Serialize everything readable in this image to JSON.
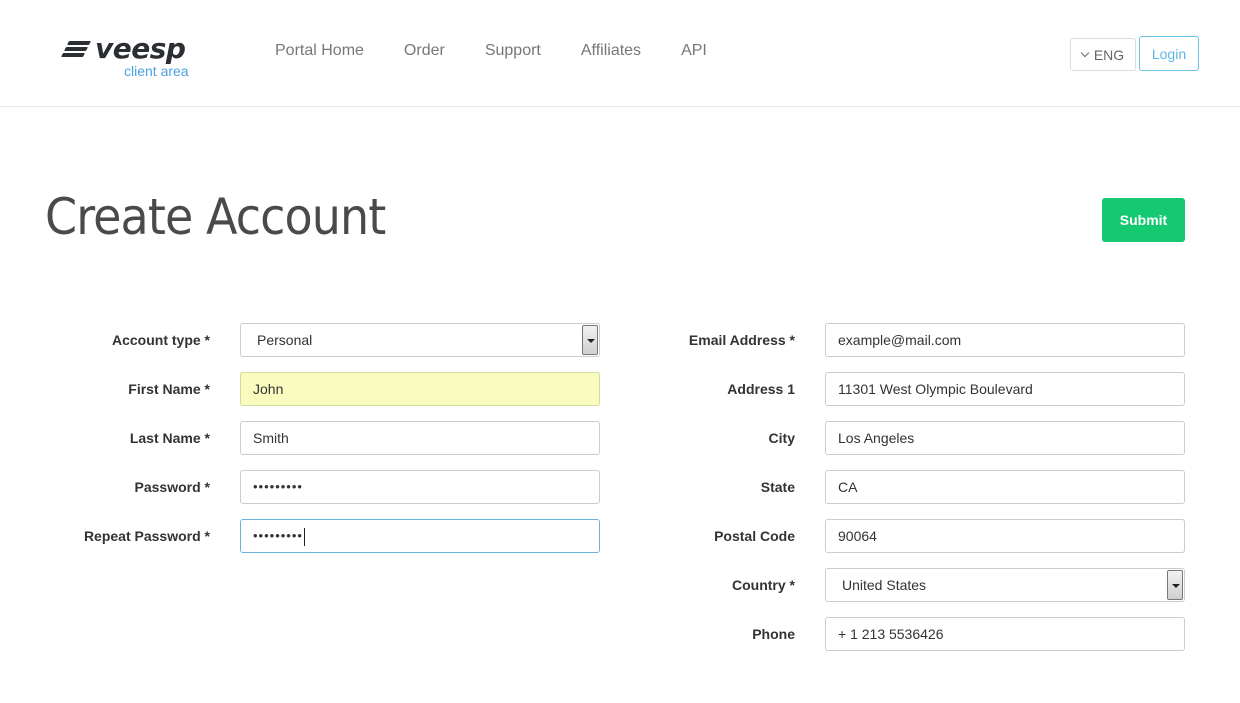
{
  "header": {
    "logo_word": "veesp",
    "logo_sub": "client area",
    "nav": [
      "Portal Home",
      "Order",
      "Support",
      "Affiliates",
      "API"
    ],
    "lang": "ENG",
    "login": "Login"
  },
  "page": {
    "title": "Create Account",
    "submit": "Submit"
  },
  "form_left": [
    {
      "label": "Account type *",
      "value": "Personal",
      "type": "select"
    },
    {
      "label": "First Name *",
      "value": "John",
      "type": "autofill"
    },
    {
      "label": "Last Name *",
      "value": "Smith",
      "type": "text"
    },
    {
      "label": "Password *",
      "value": "•••••••••",
      "type": "password"
    },
    {
      "label": "Repeat Password *",
      "value": "•••••••••",
      "type": "password-focus"
    }
  ],
  "form_right": [
    {
      "label": "Email Address *",
      "value": "example@mail.com",
      "type": "text"
    },
    {
      "label": "Address 1",
      "value": "11301 West Olympic Boulevard",
      "type": "text"
    },
    {
      "label": "City",
      "value": "Los Angeles",
      "type": "text"
    },
    {
      "label": "State",
      "value": "CA",
      "type": "text"
    },
    {
      "label": "Postal Code",
      "value": "90064",
      "type": "text"
    },
    {
      "label": "Country *",
      "value": "United States",
      "type": "select"
    },
    {
      "label": "Phone",
      "value": "+ 1 213 5536426",
      "type": "text"
    }
  ],
  "colors": {
    "submit": "#14c96f",
    "login_border": "#6cc3e6",
    "autofill": "#fafcbf",
    "logo_sub": "#4aa3df"
  }
}
